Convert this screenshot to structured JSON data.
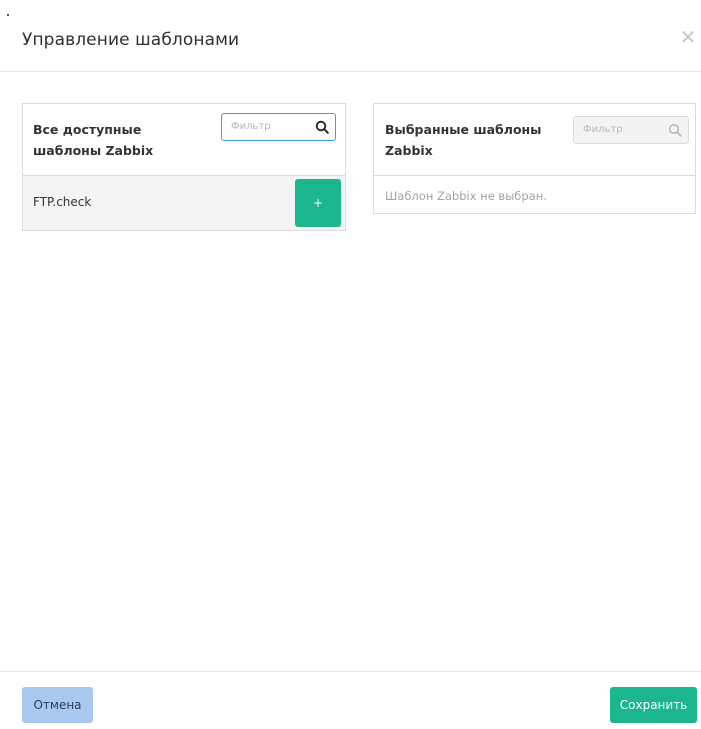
{
  "dialog": {
    "title": "Управление шаблонами",
    "close_icon": "close-icon"
  },
  "available": {
    "title": "Все доступные шаблоны Zabbix",
    "filter_placeholder": "Фильтр",
    "items": [
      {
        "label": "FTP.check",
        "add_label": "+"
      }
    ]
  },
  "selected": {
    "title": "Выбранные шаблоны Zabbix",
    "filter_placeholder": "Фильтр",
    "empty_message": "Шаблон Zabbix не выбран."
  },
  "footer": {
    "cancel_label": "Отмена",
    "save_label": "Сохранить"
  },
  "colors": {
    "primary_green": "#1bb58e",
    "cancel_blue": "#a9c8f0",
    "focus_border": "#3c9fd8"
  }
}
